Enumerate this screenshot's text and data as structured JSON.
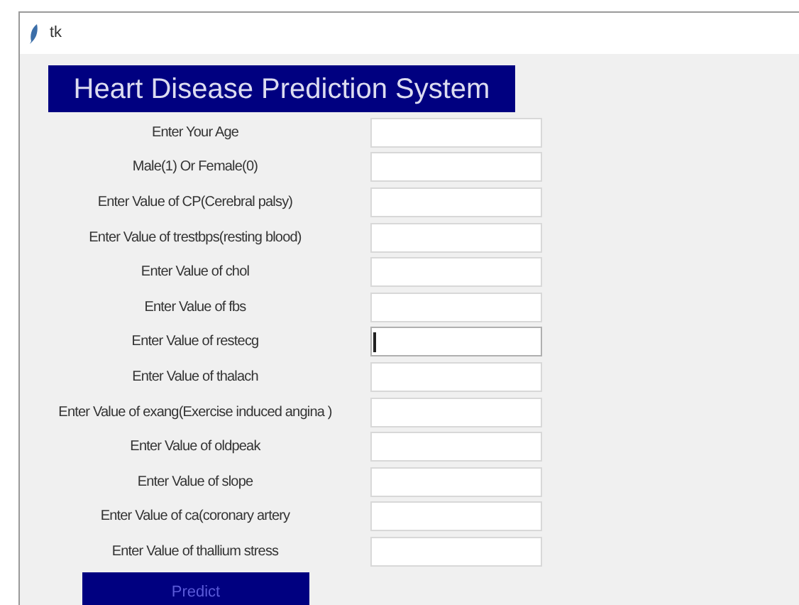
{
  "window": {
    "title": "tk"
  },
  "heading": "Heart Disease Prediction System",
  "fields": [
    {
      "label": "Enter Your Age",
      "focused": false
    },
    {
      "label": "Male(1) Or Female(0)",
      "focused": false
    },
    {
      "label": "Enter Value of CP(Cerebral palsy)",
      "focused": false
    },
    {
      "label": "Enter Value of trestbps(resting blood)",
      "focused": false
    },
    {
      "label": "Enter Value of chol",
      "focused": false
    },
    {
      "label": "Enter Value of fbs",
      "focused": false
    },
    {
      "label": "Enter Value of restecg",
      "focused": true
    },
    {
      "label": "Enter Value of thalach",
      "focused": false
    },
    {
      "label": "Enter Value of exang(Exercise induced angina )",
      "focused": false
    },
    {
      "label": "Enter Value of oldpeak",
      "focused": false
    },
    {
      "label": "Enter Value of slope",
      "focused": false
    },
    {
      "label": "Enter Value of ca(coronary artery",
      "focused": false
    },
    {
      "label": "Enter Value of thallium stress",
      "focused": false
    }
  ],
  "button": "Predict"
}
